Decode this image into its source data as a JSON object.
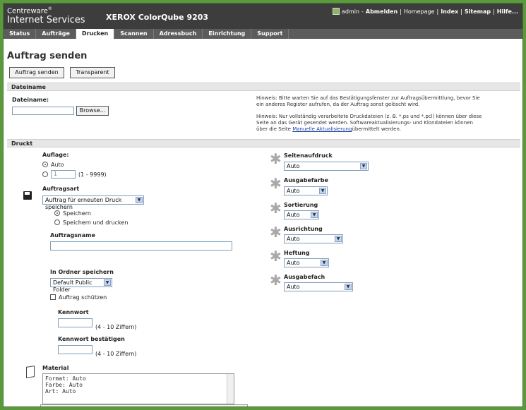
{
  "header": {
    "brand_line1": "Centreware",
    "brand_sup": "®",
    "brand_line2": "Internet Services",
    "product": "XEROX ColorQube 9203",
    "user": "admin",
    "sep": "-",
    "logout": "Abmelden",
    "links": [
      "Homepage",
      "Index",
      "Sitemap",
      "Hilfe..."
    ]
  },
  "tabs": [
    "Status",
    "Aufträge",
    "Drucken",
    "Scannen",
    "Adressbuch",
    "Einrichtung",
    "Support"
  ],
  "page": {
    "title": "Auftrag senden",
    "buttons": [
      "Auftrag senden",
      "Transparent"
    ]
  },
  "dateiname": {
    "section": "Dateiname",
    "label": "Dateiname:",
    "browse": "Browse...",
    "hint1": "Hinweis: Bitte warten Sie auf das Bestätigungsfenster zur Auftragsübermittlung, bevor Sie ein anderes Register aufrufen, da der Auftrag sonst gelöscht wird.",
    "hint2_pre": "Hinweis: Nur vollständig verarbeitete Druckdateien (z. B. *.ps und *.pcl) können über diese Seite an das Gerät gesendet werden. Softwareaktualisierungs- und Klondateien können über die Seite ",
    "hint2_link": "Manuelle Aktualisierung",
    "hint2_post": "übermittelt werden."
  },
  "druckt": {
    "section": "Druckt",
    "auflage_label": "Auflage:",
    "auflage_auto": "Auto",
    "auflage_value": "1",
    "auflage_range": "(1 - 9999)",
    "auftragsart_label": "Auftragsart",
    "auftragsart_value": "Auftrag für erneuten Druck speichern",
    "speichern": "Speichern",
    "speichern_drucken": "Speichern und drucken",
    "auftragsname_label": "Auftragsname",
    "ordner_label": "In Ordner speichern",
    "ordner_value": "Default Public Folder",
    "schuetzen": "Auftrag schützen",
    "kennwort_label": "Kennwort",
    "kennwort_hint": "(4 - 10 Ziffern)",
    "kennwort2_label": "Kennwort bestätigen",
    "kennwort2_hint": "(4 - 10 Ziffern)",
    "material_label": "Material",
    "material_text": "Format: Auto\nFarbe: Auto\nArt: Auto"
  },
  "right_options": [
    {
      "label": "Seitenaufdruck",
      "value": "Auto"
    },
    {
      "label": "Ausgabefarbe",
      "value": "Auto"
    },
    {
      "label": "Sortierung",
      "value": "Auto"
    },
    {
      "label": "Ausrichtung",
      "value": "Auto"
    },
    {
      "label": "Heftung",
      "value": "Auto"
    },
    {
      "label": "Ausgabefach",
      "value": "Auto"
    }
  ]
}
